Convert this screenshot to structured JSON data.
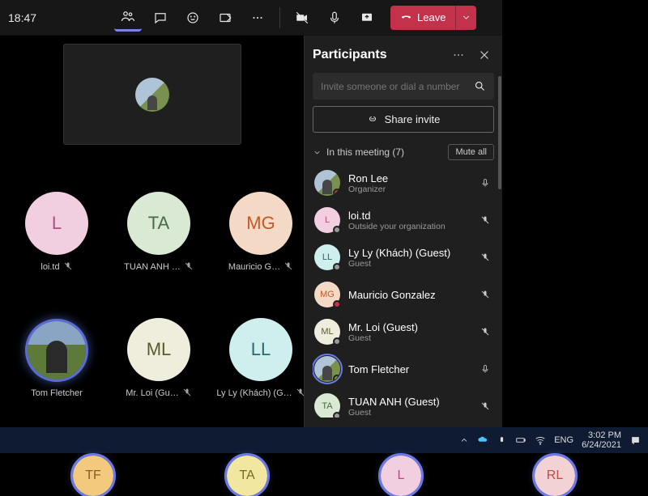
{
  "header": {
    "clock": "18:47",
    "leave_label": "Leave"
  },
  "spotlight_has_photo": true,
  "tiles": [
    {
      "initials": "L",
      "bg": "#f2cfe0",
      "fg": "#b14f83",
      "name": "loi.td",
      "muted": true
    },
    {
      "initials": "TA",
      "bg": "#d9e9d3",
      "fg": "#4a6a4a",
      "name": "TUAN ANH …",
      "muted": true
    },
    {
      "initials": "MG",
      "bg": "#f3d9c6",
      "fg": "#c25a28",
      "name": "Mauricio G…",
      "muted": true
    },
    {
      "photo": true,
      "name": "Tom Fletcher",
      "muted": false,
      "speaking": true
    },
    {
      "initials": "ML",
      "bg": "#efeedd",
      "fg": "#5a5a2f",
      "name": "Mr. Loi (Gu…",
      "muted": true
    },
    {
      "initials": "LL",
      "bg": "#cfeeee",
      "fg": "#2a6a6a",
      "name": "Ly Ly (Khách) (G…",
      "muted": true
    }
  ],
  "panel": {
    "title": "Participants",
    "search_placeholder": "Invite someone or dial a number",
    "share_label": "Share invite",
    "section_label": "In this meeting (7)",
    "mute_all_label": "Mute all",
    "list": [
      {
        "name": "Ron Lee",
        "sub": "Organizer",
        "bg": "photo",
        "dot": "#c4314b",
        "mic": "on"
      },
      {
        "name": "loi.td",
        "sub": "Outside your organization",
        "initials": "L",
        "bg": "#f2cfe0",
        "fg": "#b14f83",
        "dot": "#9a9a9a",
        "mic": "muted"
      },
      {
        "name": "Ly Ly (Khách) (Guest)",
        "sub": "Guest",
        "initials": "LL",
        "bg": "#cfeeee",
        "fg": "#2a6a6a",
        "dot": "#9a9a9a",
        "mic": "muted"
      },
      {
        "name": "Mauricio Gonzalez",
        "sub": "",
        "initials": "MG",
        "bg": "#f3d9c6",
        "fg": "#c25a28",
        "dot": "#c4314b",
        "mic": "muted"
      },
      {
        "name": "Mr. Loi (Guest)",
        "sub": "Guest",
        "initials": "ML",
        "bg": "#efeedd",
        "fg": "#5a5a2f",
        "dot": "#9a9a9a",
        "mic": "muted"
      },
      {
        "name": "Tom Fletcher",
        "sub": "",
        "photo": true,
        "ring": true,
        "dot": "#6bb700",
        "mic": "on"
      },
      {
        "name": "TUAN ANH (Guest)",
        "sub": "Guest",
        "initials": "TA",
        "bg": "#d9e9d3",
        "fg": "#4a6a4a",
        "dot": "#9a9a9a",
        "mic": "muted"
      }
    ]
  },
  "taskbar": {
    "lang": "ENG",
    "time": "3:02 PM",
    "date": "6/24/2021"
  },
  "strip": [
    {
      "initials": "TF",
      "bg": "#f3c97e",
      "fg": "#8a5a20"
    },
    {
      "initials": "TA",
      "bg": "#f2e7a0",
      "fg": "#7a6a20"
    },
    {
      "initials": "L",
      "bg": "#f2cfe0",
      "fg": "#b14f83"
    },
    {
      "initials": "RL",
      "bg": "#f2d2d2",
      "fg": "#c04a4a"
    }
  ]
}
